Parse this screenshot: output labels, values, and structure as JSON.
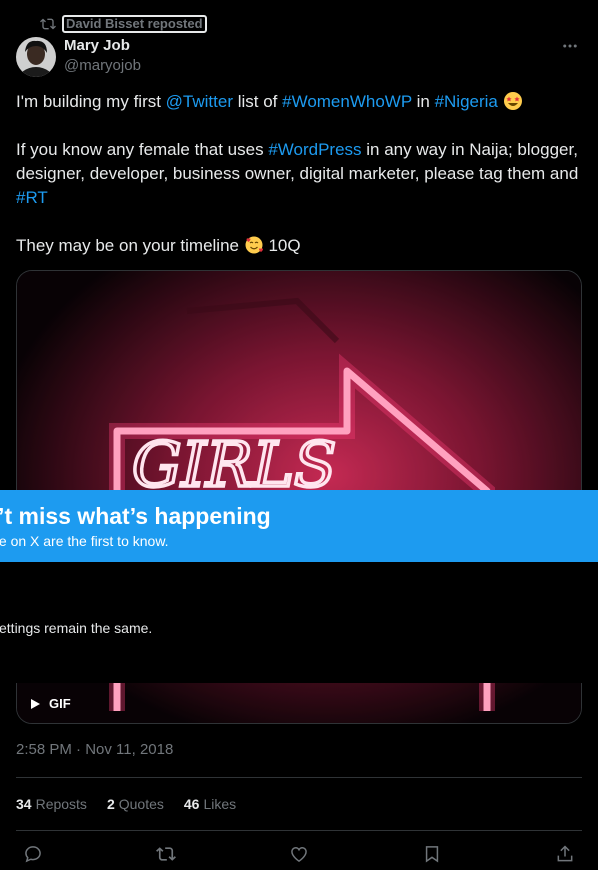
{
  "repost": {
    "label": "David Bisset reposted"
  },
  "author": {
    "name": "Mary Job",
    "handle": "@maryojob"
  },
  "tweet": {
    "line1": {
      "pre": "I'm building my first ",
      "mention": "@Twitter",
      "mid": " list of ",
      "tag1": "#WomenWhoWP",
      "mid2": " in ",
      "tag2": "#Nigeria"
    },
    "line2": {
      "pre": "If you know any female that uses ",
      "tag": "#WordPress",
      "post": " in any way in Naija; blogger, designer, developer, business owner, digital marketer, please tag them and ",
      "tag2": "#RT"
    },
    "line3": {
      "pre": "They may be on your timeline ",
      "post": " 10Q"
    }
  },
  "media": {
    "badge": "GIF"
  },
  "banner": {
    "title": "n’t miss what’s happening",
    "subtitle": "ple on X are the first to know."
  },
  "overlay": {
    "note": "settings remain the same."
  },
  "timestamp": "2:58 PM · Nov 11, 2018",
  "stats": {
    "reposts": {
      "count": "34",
      "label": "Reposts"
    },
    "quotes": {
      "count": "2",
      "label": "Quotes"
    },
    "likes": {
      "count": "46",
      "label": "Likes"
    }
  },
  "colors": {
    "accent": "#1d9bf0",
    "muted": "#71767b",
    "text": "#e7e9ea",
    "border": "#2f3336",
    "neon": "#ff2d6f"
  },
  "icons": [
    "repost-icon",
    "more-icon",
    "play-icon",
    "reply-icon",
    "like-icon",
    "bookmark-icon",
    "share-icon"
  ]
}
